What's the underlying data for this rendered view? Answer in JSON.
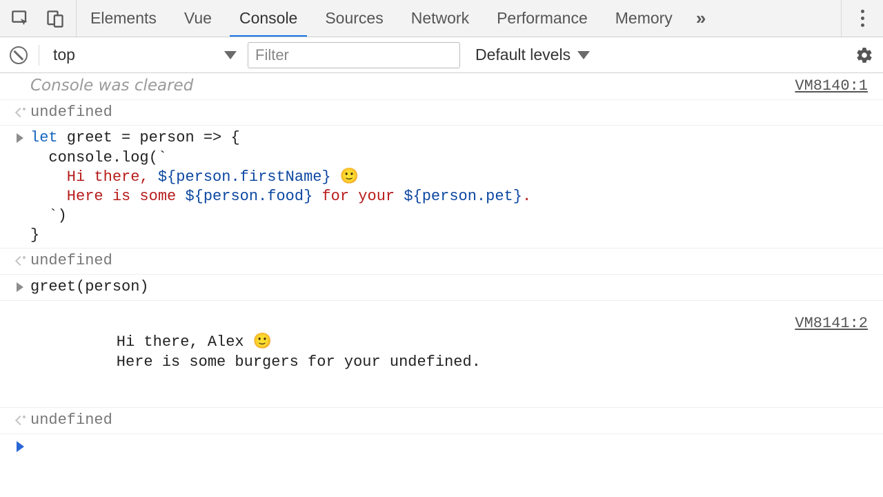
{
  "tabs": {
    "items": [
      "Elements",
      "Vue",
      "Console",
      "Sources",
      "Network",
      "Performance",
      "Memory"
    ],
    "active": "Console"
  },
  "toolbar": {
    "context": "top",
    "filter_placeholder": "Filter",
    "levels_label": "Default levels"
  },
  "console": {
    "cleared_msg": "Console was cleared",
    "cleared_src": "VM8140:1",
    "return_undefined": "undefined",
    "code": {
      "line1_let": "let",
      "line1_rest": " greet = person => {",
      "line2": "  console.log(`",
      "line3_pre": "    Hi there, ",
      "line3_interp": "${person.firstName}",
      "line3_post": " 🙂",
      "line4_pre": "    Here is some ",
      "line4_i1": "${person.food}",
      "line4_mid": " for your ",
      "line4_i2": "${person.pet}",
      "line4_post": ".",
      "line5": "  `)",
      "line6": "}"
    },
    "call": "greet(person)",
    "output_src": "VM8141:2",
    "output_text": "\n    Hi there, Alex 🙂\n    Here is some burgers for your undefined.\n  "
  }
}
